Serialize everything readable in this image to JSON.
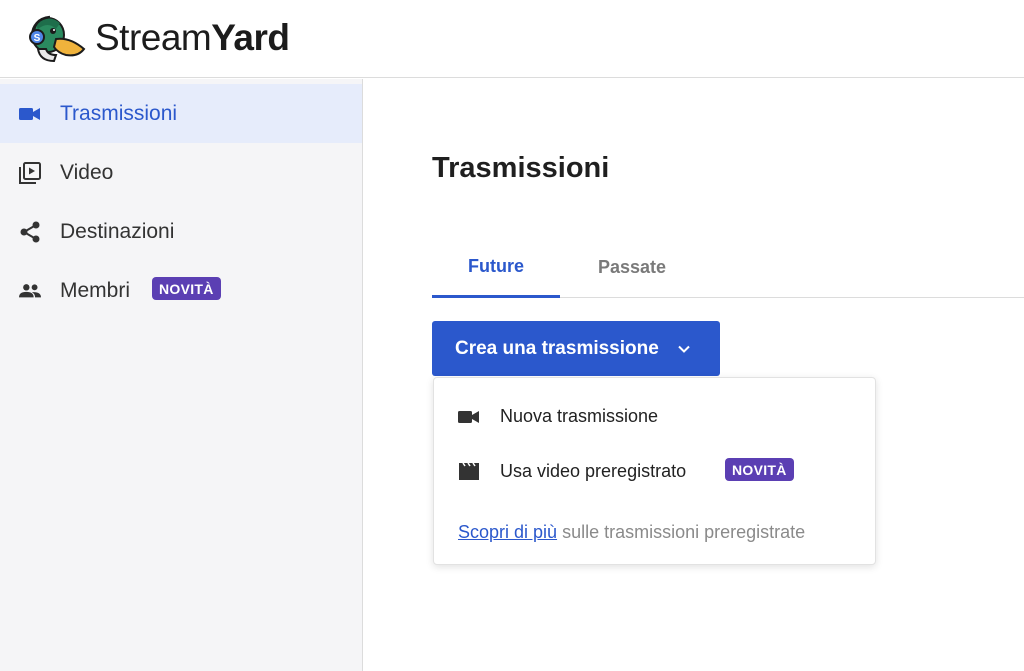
{
  "brand": {
    "name_regular": "Stream",
    "name_bold": "Yard",
    "logo_letter": "S"
  },
  "sidebar": {
    "items": [
      {
        "label": "Trasmissioni",
        "icon": "video-camera-icon",
        "active": true
      },
      {
        "label": "Video",
        "icon": "video-library-icon",
        "active": false
      },
      {
        "label": "Destinazioni",
        "icon": "share-icon",
        "active": false
      },
      {
        "label": "Membri",
        "icon": "people-icon",
        "active": false,
        "badge": "NOVITÀ"
      }
    ]
  },
  "main": {
    "title": "Trasmissioni",
    "tabs": [
      {
        "label": "Future",
        "active": true
      },
      {
        "label": "Passate",
        "active": false
      }
    ],
    "create_button": {
      "label": "Crea una trasmissione",
      "icon": "chevron-down-icon"
    },
    "dropdown": {
      "items": [
        {
          "label": "Nuova trasmissione",
          "icon": "video-camera-icon"
        },
        {
          "label": "Usa video preregistrato",
          "icon": "clapperboard-icon",
          "badge": "NOVITÀ"
        }
      ],
      "footer_link": "Scopri di più",
      "footer_text": " sulle trasmissioni preregistrate"
    }
  },
  "colors": {
    "accent": "#2b58cc",
    "badge": "#5b3fb3",
    "sidebar_bg": "#f5f5f7",
    "sidebar_active_bg": "#e6ecfb"
  }
}
